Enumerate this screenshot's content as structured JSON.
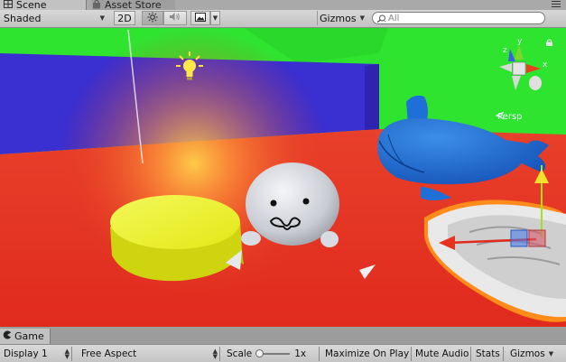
{
  "tabs": {
    "scene_label": "Scene",
    "asset_store_label": "Asset Store"
  },
  "scene_toolbar": {
    "shading_mode": "Shaded",
    "mode_2d_label": "2D",
    "gizmos_label": "Gizmos",
    "search_placeholder": "All"
  },
  "viewport": {
    "camera_mode_label": "Persp",
    "axis_labels": {
      "y": "y",
      "x": "x",
      "z": "z"
    },
    "colors": {
      "floor": "#e23322",
      "back_wall": "#3a2fd0",
      "side_wall": "#2ee82e",
      "cushion": "#e6ee1e",
      "whale": "#1f6fd8",
      "seal": "#dcdfe6"
    }
  },
  "game_tab": {
    "label": "Game"
  },
  "game_toolbar": {
    "display_label": "Display 1",
    "aspect_label": "Free Aspect",
    "scale_label": "Scale",
    "scale_value": "1x",
    "maximize_label": "Maximize On Play",
    "mute_label": "Mute Audio",
    "stats_label": "Stats",
    "gizmos_label": "Gizmos"
  },
  "icons": {
    "scene_tab": "grid-icon",
    "asset_store_tab": "store-bag-icon",
    "lighting_toggle": "sun-icon",
    "audio_toggle": "speaker-icon",
    "effects_toggle": "image-icon",
    "search": "search-icon",
    "game_tab": "pacman-icon",
    "scene_light": "lightbulb-icon",
    "viewport_lock": "lock-icon"
  }
}
